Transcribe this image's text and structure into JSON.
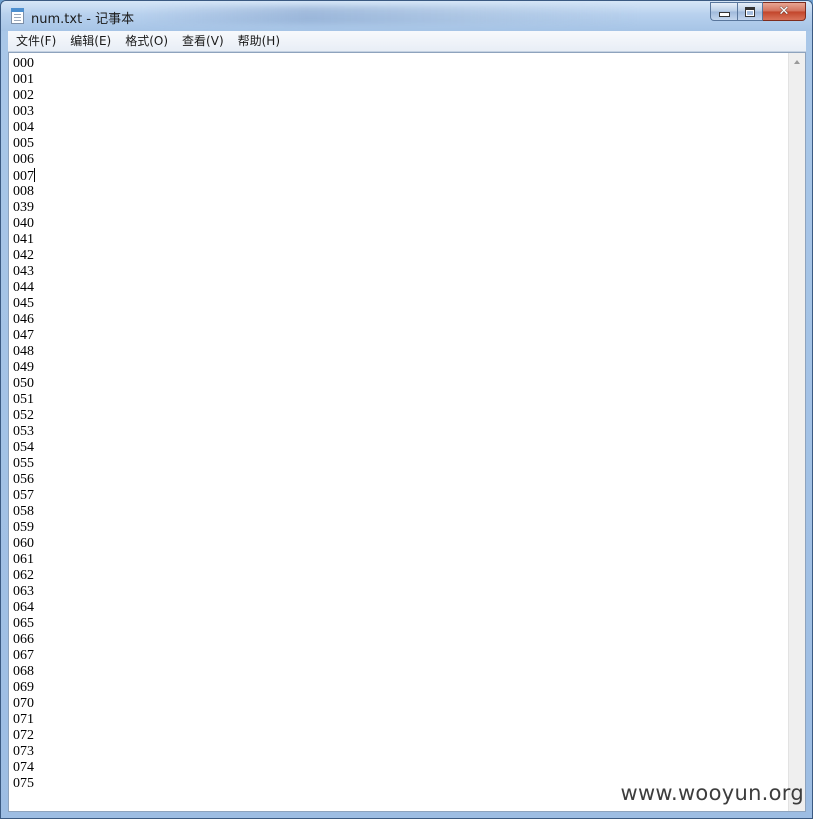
{
  "window": {
    "title": "num.txt - 记事本",
    "buttons": {
      "minimize_icon": "minimize-icon",
      "maximize_icon": "maximize-icon",
      "close_icon": "close-icon"
    }
  },
  "menu": [
    {
      "label": "文件(F)"
    },
    {
      "label": "编辑(E)"
    },
    {
      "label": "格式(O)"
    },
    {
      "label": "查看(V)"
    },
    {
      "label": "帮助(H)"
    }
  ],
  "document": {
    "lines": [
      "000",
      "001",
      "002",
      "003",
      "004",
      "005",
      "006",
      "007",
      "008",
      "039",
      "040",
      "041",
      "042",
      "043",
      "044",
      "045",
      "046",
      "047",
      "048",
      "049",
      "050",
      "051",
      "052",
      "053",
      "054",
      "055",
      "056",
      "057",
      "058",
      "059",
      "060",
      "061",
      "062",
      "063",
      "064",
      "065",
      "066",
      "067",
      "068",
      "069",
      "070",
      "071",
      "072",
      "073",
      "074",
      "075"
    ],
    "caret_after_line_index": 7
  },
  "watermark": "www.wooyun.org",
  "colors": {
    "frame": "#a9c7e8",
    "close_button": "#c2442a",
    "editor_background": "#ffffff",
    "text": "#000000"
  }
}
